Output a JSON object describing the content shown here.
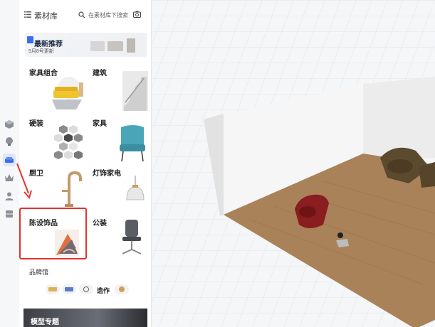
{
  "panel": {
    "title": "素材库",
    "search_placeholder": "在素材库下搜索"
  },
  "banner": {
    "title": "最新推荐",
    "subtitle": "5月8号更新"
  },
  "categories": [
    {
      "label": "家具组合"
    },
    {
      "label": "建筑"
    },
    {
      "label": "硬装"
    },
    {
      "label": "家具"
    },
    {
      "label": "厨卫"
    },
    {
      "label": "灯饰家电"
    },
    {
      "label": "陈设饰品"
    },
    {
      "label": "公装"
    }
  ],
  "brand_section": {
    "title": "品牌馆",
    "zhizuo": "造作"
  },
  "model_banner": {
    "title": "模型专题"
  },
  "colors": {
    "accent": "#3a6df0",
    "highlight": "#e5322d",
    "floor": "#a9825a"
  }
}
